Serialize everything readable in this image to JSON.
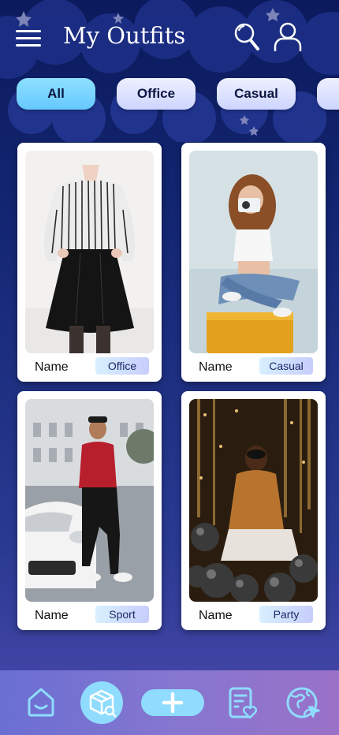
{
  "header": {
    "title": "My Outfits",
    "icons": [
      "menu-icon",
      "search-icon",
      "user-icon"
    ]
  },
  "filters": [
    {
      "label": "All",
      "active": true
    },
    {
      "label": "Office",
      "active": false
    },
    {
      "label": "Casual",
      "active": false
    }
  ],
  "outfits": [
    {
      "name": "Name",
      "tag": "Office"
    },
    {
      "name": "Name",
      "tag": "Casual"
    },
    {
      "name": "Name",
      "tag": "Sport"
    },
    {
      "name": "Name",
      "tag": "Party"
    }
  ],
  "bottom_nav": [
    "home-icon",
    "wardrobe-search-icon",
    "add-icon",
    "wishlist-icon",
    "explore-icon"
  ],
  "colors": {
    "background_top": "#0b1a5c",
    "background_bottom": "#4c49ae",
    "chip_active": "#7fd6ff",
    "chip_inactive": "#e4e8ff",
    "nav_bar": "#7c74d0",
    "nav_icon": "#8fdcff"
  }
}
